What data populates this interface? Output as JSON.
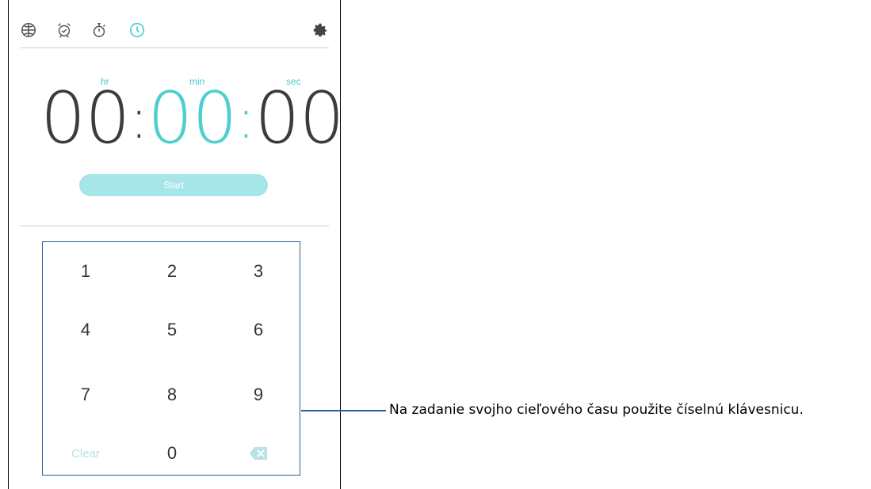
{
  "tabs": [
    {
      "icon": "globe-icon",
      "label": "World clock"
    },
    {
      "icon": "alarm-icon",
      "label": "Alarm"
    },
    {
      "icon": "stopwatch-icon",
      "label": "Stopwatch"
    },
    {
      "icon": "timer-icon",
      "label": "Timer",
      "active": true
    }
  ],
  "settings_icon": "gear-icon",
  "timer": {
    "hr_label": "hr",
    "min_label": "min",
    "sec_label": "sec",
    "hours": "00",
    "minutes": "00",
    "seconds": "00",
    "separator": ":"
  },
  "start_label": "Start",
  "keypad": {
    "keys": [
      "1",
      "2",
      "3",
      "4",
      "5",
      "6",
      "7",
      "8",
      "9",
      "Clear",
      "0"
    ],
    "backspace_icon": "backspace-icon"
  },
  "callout": "Na zadanie svojho cieľového času použite číselnú klávesnicu.",
  "colors": {
    "accent": "#4dcfd0",
    "start_button": "#a6e6e8",
    "callout": "#2a5c9a"
  }
}
